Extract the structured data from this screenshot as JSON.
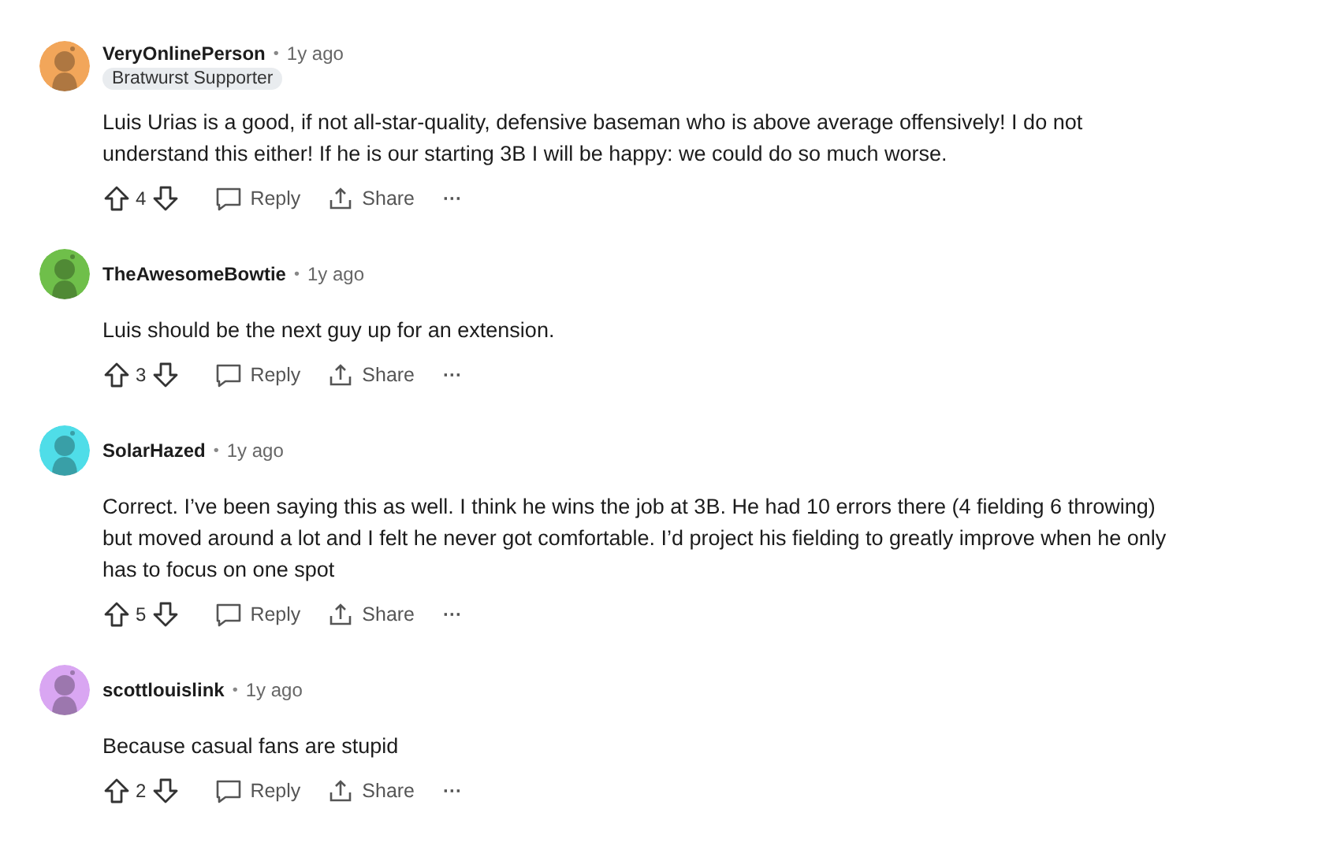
{
  "comments": [
    {
      "author": "VeryOnlinePerson",
      "separator": "•",
      "time": "1y ago",
      "flair": "Bratwurst Supporter",
      "color": "#f2a65a",
      "text": "Luis Urias is a good, if not all-star-quality, defensive baseman who is above average offensively! I do not understand this either! If he is our starting 3B I will be happy: we could do so much worse.",
      "votes": "4",
      "reply": "Reply",
      "share": "Share",
      "more": "···"
    },
    {
      "author": "TheAwesomeBowtie",
      "separator": "•",
      "time": "1y ago",
      "color": "#6fbf4a",
      "text": "Luis should be the next guy up for an extension.",
      "votes": "3",
      "reply": "Reply",
      "share": "Share",
      "more": "···"
    },
    {
      "author": "SolarHazed",
      "separator": "•",
      "time": "1y ago",
      "color": "#4fdde8",
      "text": "Correct. I’ve been saying this as well. I think he wins the job at 3B. He had 10 errors there (4 fielding 6 throwing) but moved around a lot and I felt he never got comfortable. I’d project his fielding to greatly improve when he only has to focus on one spot",
      "votes": "5",
      "reply": "Reply",
      "share": "Share",
      "more": "···"
    },
    {
      "author": "scottlouislink",
      "separator": "•",
      "time": "1y ago",
      "color": "#d9a6f2",
      "text": "Because casual fans are stupid",
      "votes": "2",
      "reply": "Reply",
      "share": "Share",
      "more": "···"
    }
  ]
}
